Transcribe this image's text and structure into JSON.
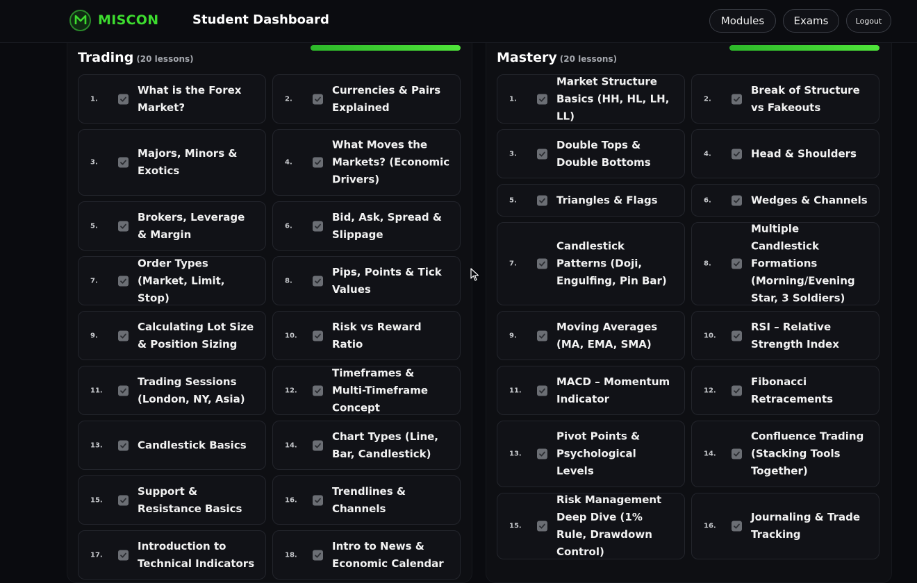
{
  "header": {
    "brand": "MISCON",
    "title": "Student Dashboard",
    "nav": {
      "modules": "Modules",
      "exams": "Exams",
      "logout": "Logout"
    }
  },
  "colors": {
    "accent": "#3ddc2f",
    "background": "#0a0b0f",
    "card": "#111217"
  },
  "sections": [
    {
      "title": "Trading",
      "count": "(20 lessons)",
      "lessons": [
        {
          "num": "1.",
          "title": "What is the Forex Market?"
        },
        {
          "num": "2.",
          "title": "Currencies & Pairs Explained"
        },
        {
          "num": "3.",
          "title": "Majors, Minors & Exotics"
        },
        {
          "num": "4.",
          "title": "What Moves the Markets? (Economic Drivers)"
        },
        {
          "num": "5.",
          "title": "Brokers, Leverage & Margin"
        },
        {
          "num": "6.",
          "title": "Bid, Ask, Spread & Slippage"
        },
        {
          "num": "7.",
          "title": "Order Types (Market, Limit, Stop)"
        },
        {
          "num": "8.",
          "title": "Pips, Points & Tick Values"
        },
        {
          "num": "9.",
          "title": "Calculating Lot Size & Position Sizing"
        },
        {
          "num": "10.",
          "title": "Risk vs Reward Ratio"
        },
        {
          "num": "11.",
          "title": "Trading Sessions (London, NY, Asia)"
        },
        {
          "num": "12.",
          "title": "Timeframes & Multi-Timeframe Concept"
        },
        {
          "num": "13.",
          "title": "Candlestick Basics"
        },
        {
          "num": "14.",
          "title": "Chart Types (Line, Bar, Candlestick)"
        },
        {
          "num": "15.",
          "title": "Support & Resistance Basics"
        },
        {
          "num": "16.",
          "title": "Trendlines & Channels"
        },
        {
          "num": "17.",
          "title": "Introduction to Technical Indicators"
        },
        {
          "num": "18.",
          "title": "Intro to News & Economic Calendar"
        }
      ]
    },
    {
      "title": "Mastery",
      "count": "(20 lessons)",
      "lessons": [
        {
          "num": "1.",
          "title": "Market Structure Basics (HH, HL, LH, LL)"
        },
        {
          "num": "2.",
          "title": "Break of Structure vs Fakeouts"
        },
        {
          "num": "3.",
          "title": "Double Tops & Double Bottoms"
        },
        {
          "num": "4.",
          "title": "Head & Shoulders"
        },
        {
          "num": "5.",
          "title": "Triangles & Flags"
        },
        {
          "num": "6.",
          "title": "Wedges & Channels"
        },
        {
          "num": "7.",
          "title": "Candlestick Patterns (Doji, Engulfing, Pin Bar)"
        },
        {
          "num": "8.",
          "title": "Multiple Candlestick Formations (Morning/Evening Star, 3 Soldiers)"
        },
        {
          "num": "9.",
          "title": "Moving Averages (MA, EMA, SMA)"
        },
        {
          "num": "10.",
          "title": "RSI – Relative Strength Index"
        },
        {
          "num": "11.",
          "title": "MACD – Momentum Indicator"
        },
        {
          "num": "12.",
          "title": "Fibonacci Retracements"
        },
        {
          "num": "13.",
          "title": "Pivot Points & Psychological Levels"
        },
        {
          "num": "14.",
          "title": "Confluence Trading (Stacking Tools Together)"
        },
        {
          "num": "15.",
          "title": "Risk Management Deep Dive (1% Rule, Drawdown Control)"
        },
        {
          "num": "16.",
          "title": "Journaling & Trade Tracking"
        }
      ]
    }
  ]
}
